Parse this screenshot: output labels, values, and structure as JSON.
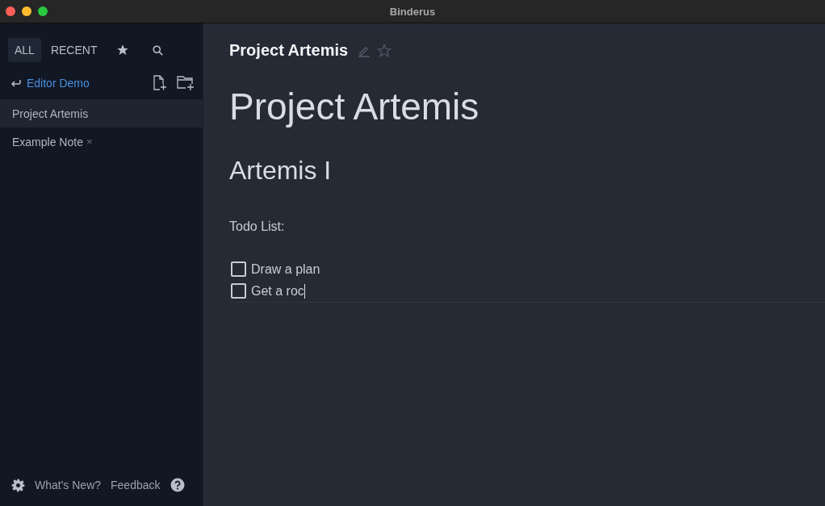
{
  "window": {
    "title": "Binderus"
  },
  "sidebar": {
    "tabs": [
      {
        "kind": "text",
        "label": "ALL",
        "selected": true
      },
      {
        "kind": "text",
        "label": "RECENT",
        "selected": false
      },
      {
        "kind": "star",
        "selected": false
      },
      {
        "kind": "search",
        "selected": false
      }
    ],
    "folder": {
      "name": "Editor Demo"
    },
    "notes": [
      {
        "title": "Project Artemis",
        "selected": true
      },
      {
        "title": "Example Note",
        "selected": false,
        "close_mark": "×"
      }
    ],
    "footer": {
      "links": [
        "What's New?",
        "Feedback"
      ]
    }
  },
  "editor": {
    "title": "Project Artemis",
    "starred": false,
    "heading_1": "Project Artemis",
    "heading_2": "Artemis I",
    "paragraph": "Todo List:",
    "todos": [
      {
        "text": "Draw a plan",
        "checked": false
      },
      {
        "text": "Get a roc",
        "checked": false
      }
    ]
  }
}
